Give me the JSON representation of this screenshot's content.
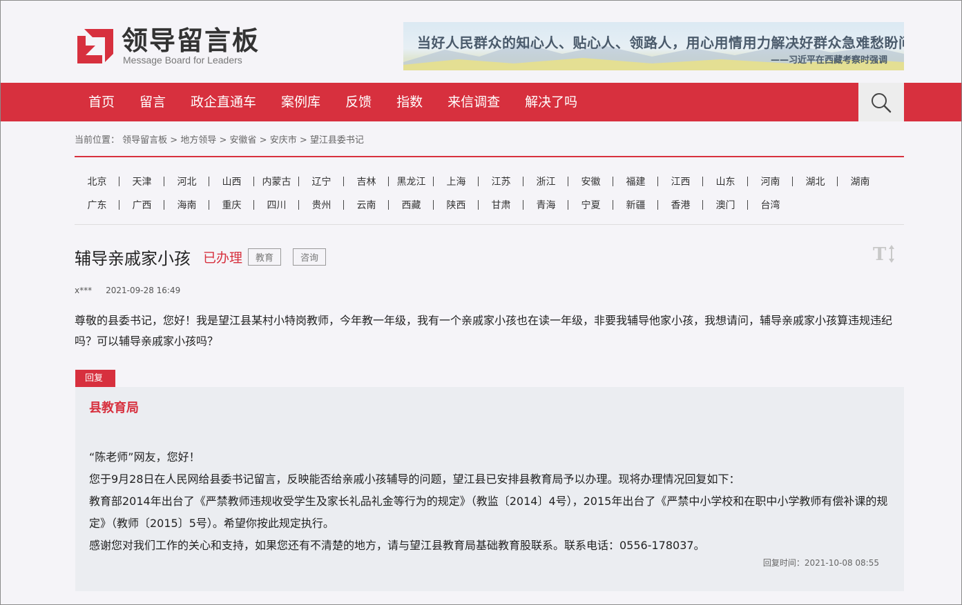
{
  "header": {
    "logo_cn": "领导留言板",
    "logo_en": "Message Board for Leaders",
    "banner_main": "当好人民群众的知心人、贴心人、领路人，用心用情用力解决好群众急难愁盼问题。",
    "banner_sub": "——习近平在西藏考察时强调"
  },
  "nav": {
    "items": [
      "首页",
      "留言",
      "政企直通车",
      "案例库",
      "反馈",
      "指数",
      "来信调查",
      "解决了吗"
    ],
    "search_icon": "search-icon"
  },
  "breadcrumb": {
    "prefix": "当前位置：",
    "items": [
      "领导留言板",
      "地方领导",
      "安徽省",
      "安庆市",
      "望江县委书记"
    ],
    "separator": " > "
  },
  "provinces": {
    "row1": [
      "北京",
      "天津",
      "河北",
      "山西",
      "内蒙古",
      "辽宁",
      "吉林",
      "黑龙江",
      "上海",
      "江苏",
      "浙江",
      "安徽",
      "福建",
      "江西",
      "山东",
      "河南",
      "湖北",
      "湖南"
    ],
    "row2": [
      "广东",
      "广西",
      "海南",
      "重庆",
      "四川",
      "贵州",
      "云南",
      "西藏",
      "陕西",
      "甘肃",
      "青海",
      "宁夏",
      "新疆",
      "香港",
      "澳门",
      "台湾"
    ]
  },
  "message": {
    "title": "辅导亲戚家小孩",
    "status": "已办理",
    "tags": [
      "教育",
      "咨询"
    ],
    "author": "x***",
    "date": "2021-09-28 16:49",
    "content": "尊敬的县委书记，您好！我是望江县某村小特岗教师，今年教一年级，我有一个亲戚家小孩也在读一年级，非要我辅导他家小孩，我想请问，辅导亲戚家小孩算违规违纪吗？可以辅导亲戚家小孩吗？",
    "font_size_icon": "font-size-icon"
  },
  "reply": {
    "tab_label": "回复",
    "org": "县教育局",
    "lines": [
      "“陈老师”网友，您好！",
      "您于9月28日在人民网给县委书记留言，反映能否给亲戚小孩辅导的问题，望江县已安排县教育局予以办理。现将办理情况回复如下：",
      "教育部2014年出台了《严禁教师违规收受学生及家长礼品礼金等行为的规定》（教监〔2014〕4号），2015年出台了《严禁中小学校和在职中小学教师有偿补课的规定》（教师〔2015〕5号）。希望你按此规定执行。",
      "感谢您对我们工作的关心和支持，如果您还有不清楚的地方，请与望江县教育局基础教育股联系。联系电话：0556-178037。"
    ],
    "time_label": "回复时间：",
    "time": "2021-10-08 08:55"
  },
  "colors": {
    "brand_red": "#d7303e",
    "background": "#f5f4f8",
    "reply_bg": "#ebedf1"
  }
}
